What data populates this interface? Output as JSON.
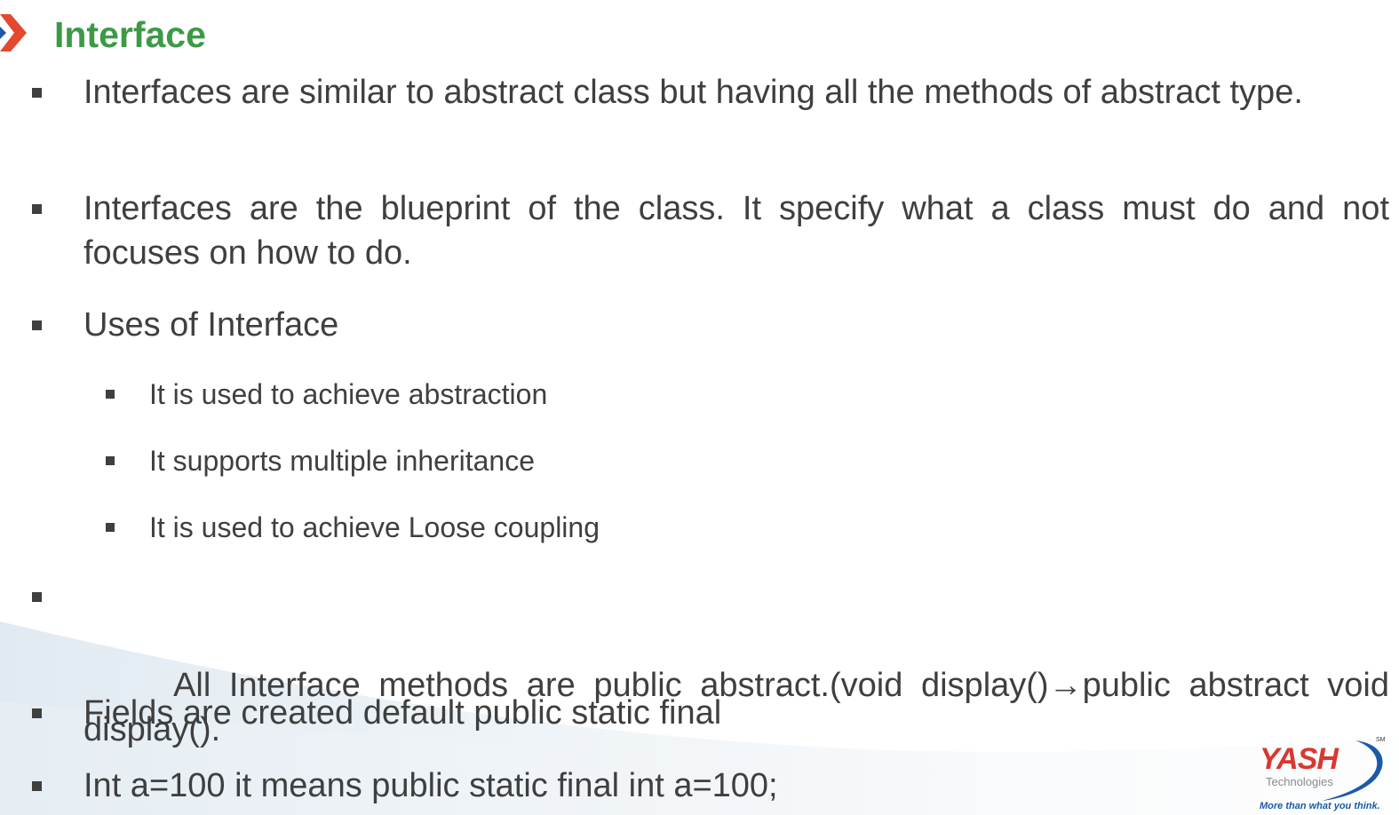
{
  "slide": {
    "title": "Interface",
    "bullets": [
      {
        "text": "Interfaces are similar to abstract class but having all the methods of abstract type."
      },
      {
        "text": "Interfaces are the blueprint of the class. It specify what a class must do and not focuses on how to do."
      },
      {
        "text": "Uses of Interface"
      },
      {
        "text": "It is used to achieve abstraction"
      },
      {
        "text": "It supports multiple inheritance"
      },
      {
        "text": "It is used to achieve Loose coupling"
      },
      {
        "text": " All Interface methods are public abstract.(void display()→public abstract void display()."
      },
      {
        "text": "Fields are created default public static final"
      },
      {
        "text": "Int a=100 it means public static final int a=100;"
      }
    ]
  },
  "logo": {
    "name": "YASH",
    "sub": "Technologies",
    "tagline": "More than what you think.",
    "mark": "SM"
  },
  "colors": {
    "title": "#3c9a46",
    "text": "#3f3f3f",
    "brand_red": "#d9382f",
    "brand_blue": "#1a5aa8"
  },
  "icons": {
    "chevron": "chevron-right-icon",
    "bullet": "square-bullet-icon"
  }
}
